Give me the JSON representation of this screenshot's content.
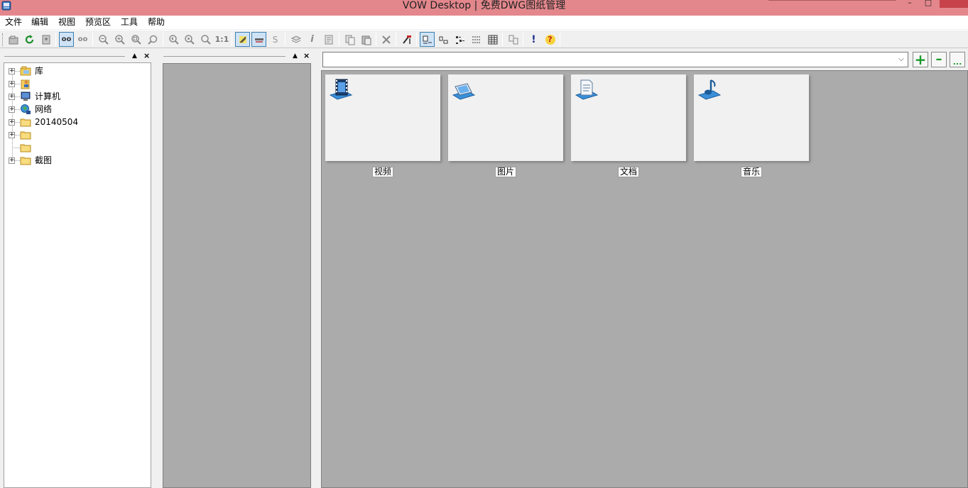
{
  "window": {
    "title": "VOW Desktop | 免费DWG图纸管理",
    "minimize": "–",
    "maximize": "□"
  },
  "menu": {
    "items": [
      {
        "label": "文件"
      },
      {
        "label": "编辑"
      },
      {
        "label": "视图"
      },
      {
        "label": "预览区"
      },
      {
        "label": "工具"
      },
      {
        "label": "帮助"
      }
    ]
  },
  "toolbar": {
    "buttons": [
      {
        "name": "open-folder-icon"
      },
      {
        "name": "refresh-icon"
      },
      {
        "name": "find-icon"
      },
      {
        "name": "view-oo-icon",
        "text": "oo"
      },
      {
        "name": "view-oo2-icon",
        "text": "oo"
      },
      {
        "name": "zoom-out-icon"
      },
      {
        "name": "zoom-in-icon"
      },
      {
        "name": "zoom-window-icon"
      },
      {
        "name": "zoom-extents-icon"
      },
      {
        "name": "zoom-previous-icon"
      },
      {
        "name": "zoom-real-icon"
      },
      {
        "name": "zoom-realtime-icon"
      },
      {
        "name": "zoom-1to1-icon",
        "text": "1:1"
      },
      {
        "name": "highlight-icon"
      },
      {
        "name": "measure-icon"
      },
      {
        "name": "style-s-icon",
        "text": "S"
      },
      {
        "name": "layers-icon"
      },
      {
        "name": "info-icon",
        "text": "i"
      },
      {
        "name": "properties-icon"
      },
      {
        "name": "copy-icon"
      },
      {
        "name": "paste-icon"
      },
      {
        "name": "delete-icon"
      },
      {
        "name": "tools-icon"
      },
      {
        "name": "large-icons-view-icon"
      },
      {
        "name": "small-icons-view-icon"
      },
      {
        "name": "list-view-icon"
      },
      {
        "name": "details-view-icon"
      },
      {
        "name": "grid-view-icon"
      },
      {
        "name": "compare-icon"
      },
      {
        "name": "exclamation-icon",
        "text": "!"
      },
      {
        "name": "help-icon",
        "text": "?"
      }
    ]
  },
  "tree": {
    "items": [
      {
        "label": "库",
        "icon": "library-icon"
      },
      {
        "label": "",
        "icon": "user-folder-icon"
      },
      {
        "label": "计算机",
        "icon": "computer-icon"
      },
      {
        "label": "网络",
        "icon": "network-icon"
      },
      {
        "label": "20140504",
        "icon": "folder-icon"
      },
      {
        "label": "",
        "icon": "folder-icon"
      },
      {
        "label": "",
        "icon": "folder-icon"
      },
      {
        "label": "截图",
        "icon": "folder-icon"
      }
    ]
  },
  "address": {
    "value": "",
    "add_button": "+",
    "remove_button": "–",
    "more_button": "..."
  },
  "gallery": {
    "items": [
      {
        "label": "视频",
        "icon": "video-icon"
      },
      {
        "label": "图片",
        "icon": "picture-icon"
      },
      {
        "label": "文档",
        "icon": "document-icon"
      },
      {
        "label": "音乐",
        "icon": "music-icon"
      }
    ]
  },
  "colors": {
    "titlebar": "#e3878c",
    "close_button": "#c7424a",
    "gallery_background": "#ababab",
    "card_background": "#f1f1f1",
    "pressed_button": "#cfe3f7"
  }
}
